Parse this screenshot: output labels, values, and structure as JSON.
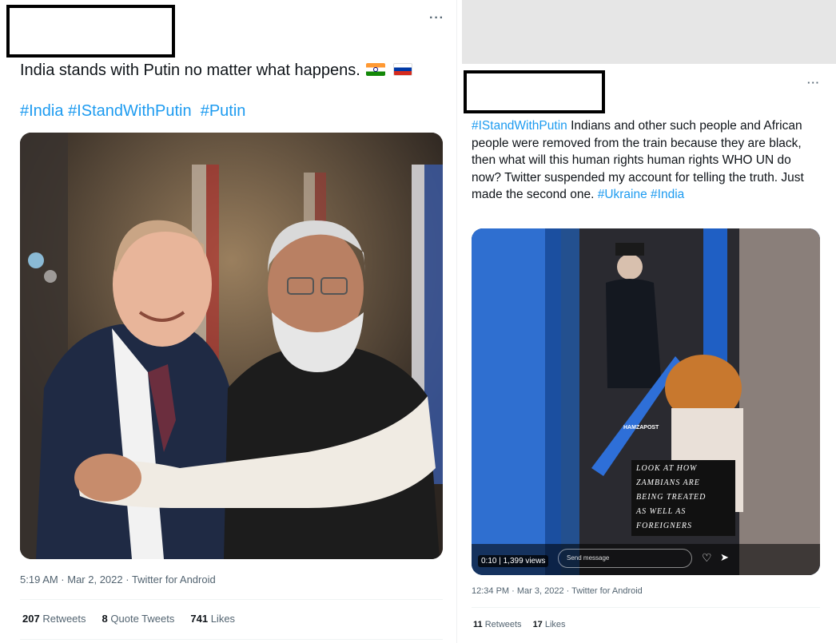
{
  "left": {
    "more_label": "···",
    "text": "India stands with Putin no matter what happens.",
    "hashtags": [
      "#India",
      "#IStandWithPutin",
      "#Putin"
    ],
    "timestamp": "5:19 AM · Mar 2, 2022 · Twitter for Android",
    "retweets_count": "207",
    "retweets_label": "Retweets",
    "quotes_count": "8",
    "quotes_label": "Quote Tweets",
    "likes_count": "741",
    "likes_label": "Likes"
  },
  "right": {
    "more_label": "···",
    "hashtag_lead": "#IStandWithPutin",
    "text": " Indians and other such people and African people were removed from the train because they are black, then what will this human rights human rights WHO UN do now? Twitter suspended my account for telling the truth.  Just made the second one. ",
    "hashtag_ukraine": "#Ukraine",
    "hashtag_india": "#India",
    "video": {
      "watermark": "HAMZAPOST",
      "caption_lines": [
        "LOOK AT HOW",
        "ZAMBIANS ARE",
        "BEING TREATED",
        "AS WELL AS",
        "FOREIGNERS"
      ],
      "time": "0:10",
      "views": "1,399 views",
      "send_placeholder": "Send message"
    },
    "timestamp": "12:34 PM · Mar 3, 2022 · Twitter for Android",
    "retweets_count": "11",
    "retweets_label": "Retweets",
    "likes_count": "17",
    "likes_label": "Likes"
  },
  "colors": {
    "hashtag": "#1d9bf0",
    "muted": "#536471"
  }
}
